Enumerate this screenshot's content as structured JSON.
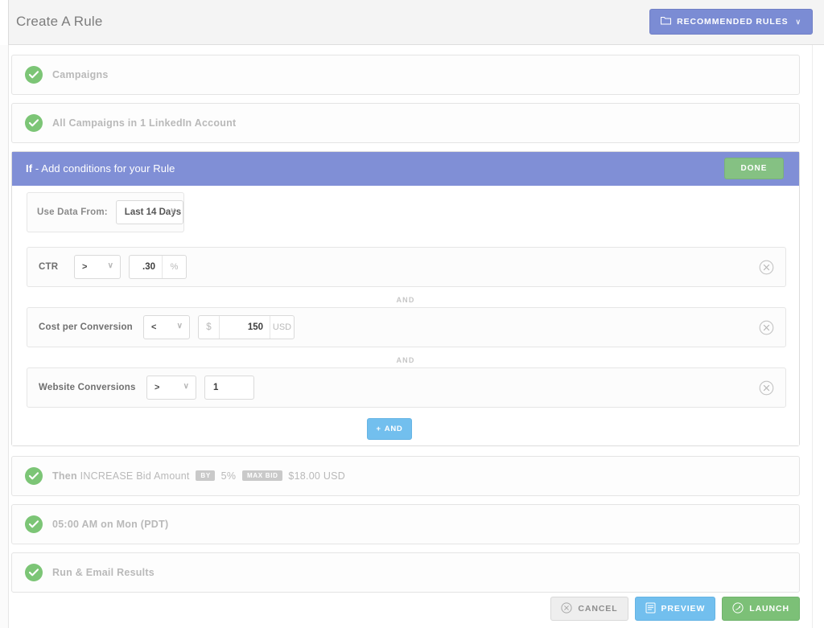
{
  "header": {
    "title": "Create A Rule",
    "recommended_rules_label": "RECOMMENDED RULES",
    "recommended_rules_icon": "folder-icon",
    "chevron": "∨",
    "accent_purple": "#7b8cd4"
  },
  "summary_rows": [
    {
      "id": "campaigns",
      "text": "Campaigns"
    },
    {
      "id": "account",
      "text": "All Campaigns in 1 LinkedIn Account"
    }
  ],
  "if_panel": {
    "title_prefix": "If",
    "title_rest": " - Add conditions for your Rule",
    "done_label": "DONE",
    "header_color": "#808fd6",
    "done_color": "#85c183",
    "date_range": {
      "label": "Use Data From:",
      "value": "Last 14 Days"
    },
    "conditions": [
      {
        "id": "ctr",
        "metric": "CTR",
        "operator": ">",
        "prefix": "",
        "value": ".30",
        "suffix": "%",
        "align": "right"
      },
      {
        "id": "cost-per-conversion",
        "metric": "Cost per Conversion",
        "operator": "<",
        "prefix": "$",
        "value": "150",
        "suffix": "USD",
        "align": "right"
      },
      {
        "id": "website-conversions",
        "metric": "Website Conversions",
        "operator": ">",
        "prefix": "",
        "value": "1",
        "suffix": "",
        "align": "left"
      }
    ],
    "separator_label": "AND",
    "add_button_label": "AND",
    "add_button_plus": "+",
    "add_button_color": "#72bfee"
  },
  "then_row": {
    "lead": "Then",
    "action": "INCREASE Bid Amount",
    "badge_by": "BY",
    "amount_percent": "5%",
    "badge_max_bid": "MAX BID",
    "max_bid_value": "$18.00 USD"
  },
  "schedule_row": {
    "text": "05:00 AM on Mon (PDT)"
  },
  "results_row": {
    "text": "Run & Email Results"
  },
  "footer": {
    "cancel_label": "CANCEL",
    "cancel_icon": "circle-x-icon",
    "preview_label": "PREVIEW",
    "preview_icon": "document-icon",
    "launch_label": "LAUNCH",
    "launch_icon": "rocket-circle-icon"
  },
  "icons": {
    "check": "check-icon",
    "remove": "circle-x-icon"
  }
}
